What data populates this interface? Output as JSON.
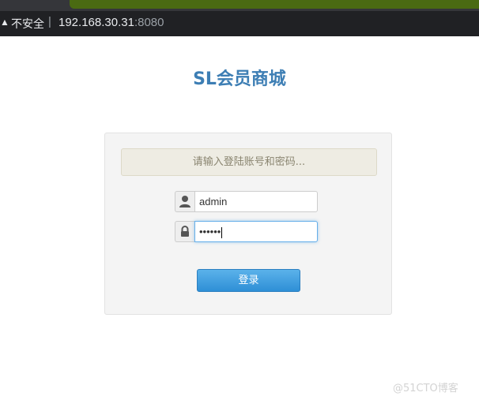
{
  "browser": {
    "security_label": "不安全",
    "separator": "|",
    "host": "192.168.30.31",
    "port": ":8080"
  },
  "page": {
    "title": "SL会员商城"
  },
  "login": {
    "hint": "请输入登陆账号和密码...",
    "username_value": "admin",
    "password_value": "••••••",
    "submit_label": "登录"
  },
  "watermark": "@51CTO博客"
}
